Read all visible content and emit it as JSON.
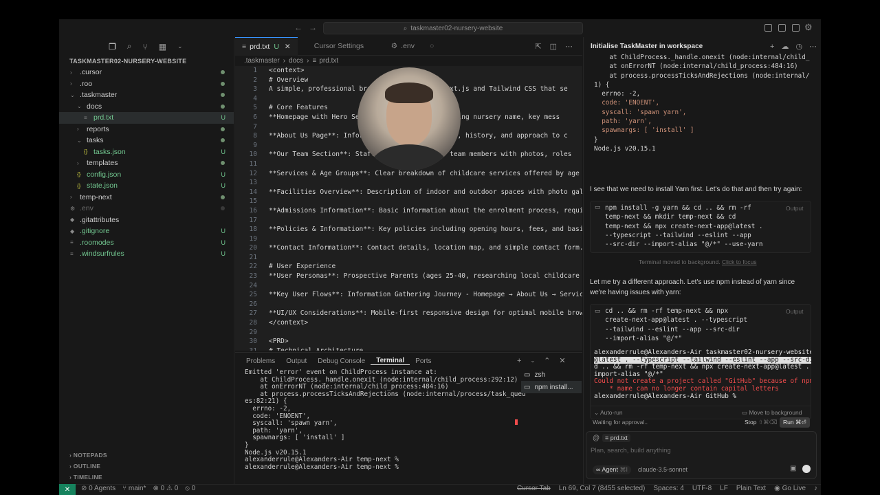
{
  "titlebar": {
    "search_text": "taskmaster02-nursery-website"
  },
  "explorer": {
    "title": "TASKMASTER02-NURSERY-WEBSITE",
    "items": [
      {
        "label": ".cursor",
        "indent": 0,
        "chev": "›",
        "status": "dot"
      },
      {
        "label": ".roo",
        "indent": 0,
        "chev": "›",
        "status": "dot"
      },
      {
        "label": ".taskmaster",
        "indent": 0,
        "chev": "⌄",
        "status": "dot"
      },
      {
        "label": "docs",
        "indent": 1,
        "chev": "⌄",
        "status": "dot"
      },
      {
        "label": "prd.txt",
        "indent": 2,
        "chev": "≡",
        "status": "U",
        "selected": true
      },
      {
        "label": "reports",
        "indent": 1,
        "chev": "›",
        "status": "dot"
      },
      {
        "label": "tasks",
        "indent": 1,
        "chev": "⌄",
        "status": "dot"
      },
      {
        "label": "tasks.json",
        "indent": 2,
        "chev": "{}",
        "status": "U"
      },
      {
        "label": "templates",
        "indent": 1,
        "chev": "›",
        "status": "dot"
      },
      {
        "label": "config.json",
        "indent": 1,
        "chev": "{}",
        "status": "U"
      },
      {
        "label": "state.json",
        "indent": 1,
        "chev": "{}",
        "status": "U"
      },
      {
        "label": "temp-next",
        "indent": 0,
        "chev": "›",
        "status": "dot"
      },
      {
        "label": ".env",
        "indent": 0,
        "chev": "⚙",
        "status": "dim-dot",
        "dim": true
      },
      {
        "label": ".gitattributes",
        "indent": 0,
        "chev": "◆",
        "status": ""
      },
      {
        "label": ".gitignore",
        "indent": 0,
        "chev": "◆",
        "status": "U"
      },
      {
        "label": ".roomodes",
        "indent": 0,
        "chev": "≡",
        "status": "U"
      },
      {
        "label": ".windsurfrules",
        "indent": 0,
        "chev": "≡",
        "status": "U"
      }
    ],
    "bottom_sections": [
      "NOTEPADS",
      "OUTLINE",
      "TIMELINE"
    ]
  },
  "editor": {
    "tabs": [
      {
        "label": "prd.txt",
        "status": "U",
        "active": true
      },
      {
        "label": "Cursor Settings",
        "status": "",
        "active": false
      },
      {
        "label": ".env",
        "status": "",
        "active": false
      }
    ],
    "breadcrumb": [
      ".taskmaster",
      "docs",
      "prd.txt"
    ],
    "lines": [
      {
        "n": "1",
        "t": "<context>"
      },
      {
        "n": "2",
        "t": "# Overview"
      },
      {
        "n": "3",
        "t": "A simple, professional bro                h Next.js and Tailwind CSS that se"
      },
      {
        "n": "4",
        "t": ""
      },
      {
        "n": "5",
        "t": "# Core Features"
      },
      {
        "n": "6",
        "t": "**Homepage with Hero Sec                  featuring nursery name, key mess"
      },
      {
        "n": "7",
        "t": ""
      },
      {
        "n": "8",
        "t": "**About Us Page**: Inform                  sophy, history, and approach to c"
      },
      {
        "n": "9",
        "t": ""
      },
      {
        "n": "10",
        "t": "**Our Team Section**: Staff               key team members with photos, roles"
      },
      {
        "n": "11",
        "t": ""
      },
      {
        "n": "12",
        "t": "**Services & Age Groups**: Clear breakdown of childcare services offered by age gro"
      },
      {
        "n": "13",
        "t": ""
      },
      {
        "n": "14",
        "t": "**Facilities Overview**: Description of indoor and outdoor spaces with photo galler"
      },
      {
        "n": "15",
        "t": ""
      },
      {
        "n": "16",
        "t": "**Admissions Information**: Basic information about the enrolment process, requirem"
      },
      {
        "n": "17",
        "t": ""
      },
      {
        "n": "18",
        "t": "**Policies & Information**: Key policies including opening hours, fees, and basic p"
      },
      {
        "n": "19",
        "t": ""
      },
      {
        "n": "20",
        "t": "**Contact Information**: Contact details, location map, and simple contact form. Es"
      },
      {
        "n": "21",
        "t": ""
      },
      {
        "n": "22",
        "t": "# User Experience"
      },
      {
        "n": "23",
        "t": "**User Personas**: Prospective Parents (ages 25-40, researching local childcare opt"
      },
      {
        "n": "24",
        "t": ""
      },
      {
        "n": "25",
        "t": "**Key User Flows**: Information Gathering Journey - Homepage → About Us → Services/"
      },
      {
        "n": "26",
        "t": ""
      },
      {
        "n": "27",
        "t": "**UI/UX Considerations**: Mobile-first responsive design for optimal mobile browsin"
      },
      {
        "n": "28",
        "t": "</context>"
      },
      {
        "n": "29",
        "t": ""
      },
      {
        "n": "30",
        "t": "<PRD>"
      },
      {
        "n": "31",
        "t": "# Technical Architecture"
      }
    ]
  },
  "panel": {
    "tabs": [
      "Problems",
      "Output",
      "Debug Console",
      "Terminal",
      "Ports"
    ],
    "active_tab": "Terminal",
    "terminal_lines": [
      "Emitted 'error' event on ChildProcess instance at:",
      "    at ChildProcess._handle.onexit (node:internal/child_process:292:12)",
      "    at onErrorNT (node:internal/child_process:484:16)",
      "    at process.processTicksAndRejections (node:internal/process/task_queu",
      "es:82:21) {",
      "  errno: -2,",
      "  code: 'ENOENT',",
      "  syscall: 'spawn yarn',",
      "  path: 'yarn',",
      "  spawnargs: [ 'install' ]",
      "}",
      "",
      "Node.js v20.15.1",
      "alexanderrule@Alexanders-Air temp-next %",
      "alexanderrule@Alexanders-Air temp-next % "
    ],
    "terminals": [
      {
        "label": "zsh",
        "active": false
      },
      {
        "label": "npm install...",
        "active": true
      }
    ]
  },
  "chat": {
    "title": "Initialise TaskMaster in workspace",
    "error_lines": [
      "    at ChildProcess._handle.onexit (node:internal/child_p",
      "    at onErrorNT (node:internal/child_process:484:16)",
      "    at process.processTicksAndRejections (node:internal/p",
      "1) {",
      "  errno: -2,",
      "  code: 'ENOENT',",
      "  syscall: 'spawn yarn',",
      "  path: 'yarn',",
      "  spawnargs: [ 'install' ]",
      "}",
      "",
      "Node.js v20.15.1"
    ],
    "msg1": "I see that we need to install Yarn first. Let's do that and then try again:",
    "cmd1_lines": [
      "npm install -g yarn && cd .. && rm -rf",
      "temp-next && mkdir temp-next && cd",
      "temp-next && npx create-next-app@latest .",
      "--typescript --tailwind --eslint --app",
      "--src-dir --import-alias \"@/*\" --use-yarn"
    ],
    "output_label": "Output",
    "bg_note": "Terminal moved to background.",
    "bg_link": "Click to focus",
    "msg2": "Let me try a different approach. Let's use npm instead of yarn since we're having issues with yarn:",
    "cmd2_lines": [
      "cd .. && rm -rf temp-next && npx",
      "create-next-app@latest . --typescript",
      "--tailwind --eslint --app --src-dir",
      "--import-alias \"@/*\""
    ],
    "term2_lines": [
      "alexanderrule@Alexanders-Air taskmaster02-nursery-website",
      "@latest . --typescript --tailwind --eslint --app --src-dir",
      "d .. && rm -rf temp-next && npx create-next-app@latest . -",
      "import-alias \"@/*\"",
      "Could not create a project called \"GitHub\" because of npm",
      "    * name can no longer contain capital letters",
      "alexanderrule@Alexanders-Air GitHub %"
    ],
    "auto_run": "Auto-run",
    "move_bg": "Move to background",
    "waiting": "Waiting for approval..",
    "stop": "Stop",
    "stop_kbd": "⇧⌘⌫",
    "run": "Run ⌘⏎",
    "context_file": "prd.txt",
    "input_placeholder": "Plan, search, build anything",
    "mode": "Agent",
    "mode_kbd": "⌘I",
    "model": "claude-3.5-sonnet"
  },
  "status": {
    "agents": "0 Agents",
    "branch": "main*",
    "errors": "0",
    "warnings": "0",
    "ports": "0",
    "cursor_tab": "Cursor Tab",
    "position": "Ln 69, Col 7 (8455 selected)",
    "spaces": "Spaces: 4",
    "encoding": "UTF-8",
    "eol": "LF",
    "language": "Plain Text",
    "golive": "Go Live"
  },
  "colors": {
    "accent": "#3794ff",
    "git_untracked": "#73c991",
    "error": "#f14c4c",
    "remote": "#16825d"
  }
}
